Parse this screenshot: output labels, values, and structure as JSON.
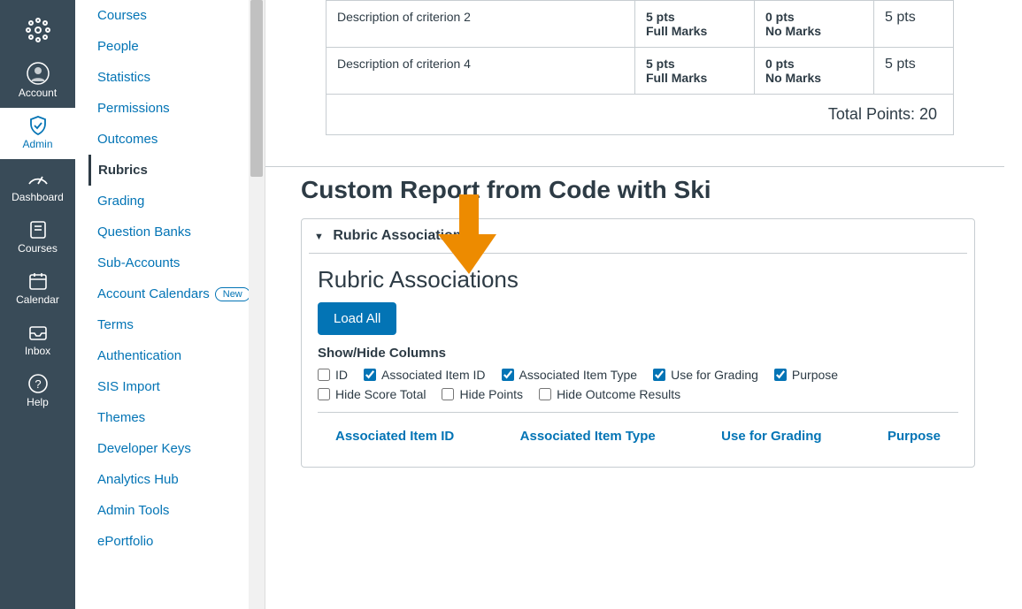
{
  "colors": {
    "accent": "#0374B5",
    "navBg": "#394B58",
    "arrow": "#ED8B00"
  },
  "globalNav": [
    {
      "id": "logo",
      "label": ""
    },
    {
      "id": "account",
      "label": "Account"
    },
    {
      "id": "admin",
      "label": "Admin",
      "active": true
    },
    {
      "id": "dashboard",
      "label": "Dashboard"
    },
    {
      "id": "courses",
      "label": "Courses"
    },
    {
      "id": "calendar",
      "label": "Calendar"
    },
    {
      "id": "inbox",
      "label": "Inbox"
    },
    {
      "id": "help",
      "label": "Help"
    }
  ],
  "contextNav": {
    "items": [
      {
        "label": "Courses"
      },
      {
        "label": "People"
      },
      {
        "label": "Statistics"
      },
      {
        "label": "Permissions"
      },
      {
        "label": "Outcomes"
      },
      {
        "label": "Rubrics",
        "active": true
      },
      {
        "label": "Grading"
      },
      {
        "label": "Question Banks"
      },
      {
        "label": "Sub-Accounts"
      },
      {
        "label": "Account Calendars",
        "badge": "New"
      },
      {
        "label": "Terms"
      },
      {
        "label": "Authentication"
      },
      {
        "label": "SIS Import"
      },
      {
        "label": "Themes"
      },
      {
        "label": "Developer Keys"
      },
      {
        "label": "Analytics Hub"
      },
      {
        "label": "Admin Tools"
      },
      {
        "label": "ePortfolio"
      }
    ]
  },
  "rubric": {
    "rows": [
      {
        "desc": "Description of criterion 2",
        "ratings": [
          {
            "pts": "5 pts",
            "label": "Full Marks"
          },
          {
            "pts": "0 pts",
            "label": "No Marks"
          }
        ],
        "points": "5 pts"
      },
      {
        "desc": "Description of criterion 4",
        "ratings": [
          {
            "pts": "5 pts",
            "label": "Full Marks"
          },
          {
            "pts": "0 pts",
            "label": "No Marks"
          }
        ],
        "points": "5 pts"
      }
    ],
    "totalLabel": "Total Points: 20"
  },
  "customReport": {
    "heading": "Custom Report from Code with Ski",
    "summary": "Rubric Associations",
    "title": "Rubric Associations",
    "loadAll": "Load All",
    "showHideLabel": "Show/Hide Columns",
    "columns": [
      {
        "label": "ID",
        "checked": false
      },
      {
        "label": "Associated Item ID",
        "checked": true
      },
      {
        "label": "Associated Item Type",
        "checked": true
      },
      {
        "label": "Use for Grading",
        "checked": true
      },
      {
        "label": "Purpose",
        "checked": true
      },
      {
        "label": "Hide Score Total",
        "checked": false
      },
      {
        "label": "Hide Points",
        "checked": false
      },
      {
        "label": "Hide Outcome Results",
        "checked": false
      }
    ],
    "headers": [
      "Associated Item ID",
      "Associated Item Type",
      "Use for Grading",
      "Purpose"
    ]
  }
}
